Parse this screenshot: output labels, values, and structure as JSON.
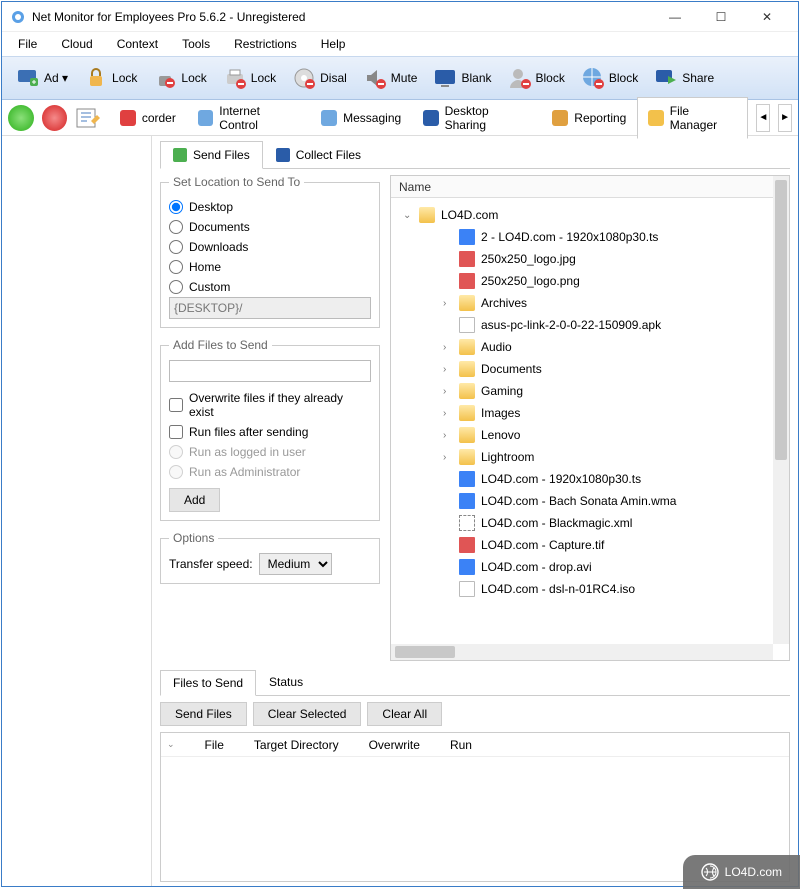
{
  "window": {
    "title": "Net Monitor for Employees Pro 5.6.2 - Unregistered"
  },
  "menu": {
    "items": [
      "File",
      "Cloud",
      "Context",
      "Tools",
      "Restrictions",
      "Help"
    ]
  },
  "toolbar": {
    "items": [
      {
        "icon": "monitor-add",
        "label": "Ad",
        "caret": true
      },
      {
        "icon": "lock-yellow",
        "label": "Lock"
      },
      {
        "icon": "lock-red",
        "label": "Lock"
      },
      {
        "icon": "printer-lock",
        "label": "Lock"
      },
      {
        "icon": "cd-disable",
        "label": "Disal"
      },
      {
        "icon": "mute",
        "label": "Mute"
      },
      {
        "icon": "monitor-blank",
        "label": "Blank"
      },
      {
        "icon": "user-block",
        "label": "Block"
      },
      {
        "icon": "globe-block",
        "label": "Block"
      },
      {
        "icon": "monitor-share",
        "label": "Share"
      }
    ]
  },
  "roundbuttons": {
    "ok": "ok-icon",
    "cancel": "cancel-icon",
    "edit": "edit-icon"
  },
  "maintabs": {
    "items": [
      {
        "icon": "rec",
        "label": "corder"
      },
      {
        "icon": "globe",
        "label": "Internet Control"
      },
      {
        "icon": "chat",
        "label": "Messaging"
      },
      {
        "icon": "monitor",
        "label": "Desktop Sharing"
      },
      {
        "icon": "chart",
        "label": "Reporting"
      },
      {
        "icon": "folder",
        "label": "File Manager",
        "active": true
      }
    ]
  },
  "subtabs": {
    "items": [
      {
        "icon": "send",
        "label": "Send Files",
        "active": true
      },
      {
        "icon": "collect",
        "label": "Collect Files"
      }
    ]
  },
  "location": {
    "legend": "Set Location to Send To",
    "options": [
      "Desktop",
      "Documents",
      "Downloads",
      "Home",
      "Custom"
    ],
    "selected": "Desktop",
    "path": "{DESKTOP}/"
  },
  "addfiles": {
    "legend": "Add Files to Send",
    "value": "",
    "checks": [
      {
        "label": "Overwrite files if they already exist",
        "checked": false,
        "enabled": true
      },
      {
        "label": "Run files after sending",
        "checked": false,
        "enabled": true
      }
    ],
    "radios": [
      {
        "label": "Run as logged in user",
        "enabled": false
      },
      {
        "label": "Run as Administrator",
        "enabled": false
      }
    ],
    "addbtn": "Add"
  },
  "options": {
    "legend": "Options",
    "speed_label": "Transfer speed:",
    "speed": "Medium"
  },
  "filelist": {
    "header": "Name",
    "root": "LO4D.com",
    "items": [
      {
        "type": "file",
        "icon": "file-blue",
        "name": "2 - LO4D.com - 1920x1080p30.ts",
        "indent": 2
      },
      {
        "type": "file",
        "icon": "file-img",
        "name": "250x250_logo.jpg",
        "indent": 2
      },
      {
        "type": "file",
        "icon": "file-img",
        "name": "250x250_logo.png",
        "indent": 2
      },
      {
        "type": "folder",
        "name": "Archives",
        "indent": 2,
        "expandable": true
      },
      {
        "type": "file",
        "icon": "file-generic",
        "name": "asus-pc-link-2-0-0-22-150909.apk",
        "indent": 2
      },
      {
        "type": "folder",
        "name": "Audio",
        "indent": 2,
        "expandable": true
      },
      {
        "type": "folder",
        "name": "Documents",
        "indent": 2,
        "expandable": true
      },
      {
        "type": "folder",
        "name": "Gaming",
        "indent": 2,
        "expandable": true
      },
      {
        "type": "folder",
        "name": "Images",
        "indent": 2,
        "expandable": true
      },
      {
        "type": "folder",
        "name": "Lenovo",
        "indent": 2,
        "expandable": true
      },
      {
        "type": "folder",
        "name": "Lightroom",
        "indent": 2,
        "expandable": true
      },
      {
        "type": "file",
        "icon": "file-blue",
        "name": "LO4D.com - 1920x1080p30.ts",
        "indent": 2
      },
      {
        "type": "file",
        "icon": "file-blue",
        "name": "LO4D.com - Bach Sonata Amin.wma",
        "indent": 2
      },
      {
        "type": "file",
        "icon": "file-xml",
        "name": "LO4D.com - Blackmagic.xml",
        "indent": 2
      },
      {
        "type": "file",
        "icon": "file-img",
        "name": "LO4D.com - Capture.tif",
        "indent": 2
      },
      {
        "type": "file",
        "icon": "file-blue",
        "name": "LO4D.com - drop.avi",
        "indent": 2
      },
      {
        "type": "file",
        "icon": "file-generic",
        "name": "LO4D.com - dsl-n-01RC4.iso",
        "indent": 2
      }
    ]
  },
  "bottomtabs": {
    "items": [
      "Files to Send",
      "Status"
    ],
    "active": "Files to Send"
  },
  "bottombtns": [
    "Send Files",
    "Clear Selected",
    "Clear All"
  ],
  "gridcols": [
    "File",
    "Target Directory",
    "Overwrite",
    "Run"
  ],
  "watermark": "LO4D.com"
}
